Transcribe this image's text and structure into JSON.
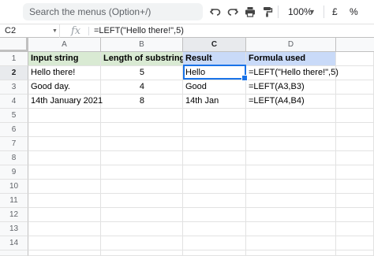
{
  "toolbar": {
    "search_placeholder": "Search the menus (Option+/)",
    "zoom": "100%",
    "currency": "£",
    "percent": "%"
  },
  "formula_bar": {
    "name_box": "C2",
    "fx": "fx",
    "formula": "=LEFT(\"Hello there!\",5)"
  },
  "columns": [
    "A",
    "B",
    "C",
    "D"
  ],
  "rows": [
    "1",
    "2",
    "3",
    "4",
    "5",
    "6",
    "7",
    "8",
    "9",
    "10",
    "11",
    "12",
    "13",
    "14",
    "15"
  ],
  "table": {
    "headers": [
      "Input string",
      "Length of substring",
      "Result",
      "Formula used"
    ],
    "data": [
      [
        "Hello there!",
        "5",
        "Hello",
        "=LEFT(\"Hello there!\",5)"
      ],
      [
        "Good day.",
        "4",
        "Good",
        "=LEFT(A3,B3)"
      ],
      [
        "14th January 2021",
        "8",
        "14th Jan",
        "=LEFT(A4,B4)"
      ]
    ]
  },
  "colors": {
    "header_green": "#d9ead3",
    "header_blue": "#c9daf8",
    "selection": "#1a73e8"
  }
}
